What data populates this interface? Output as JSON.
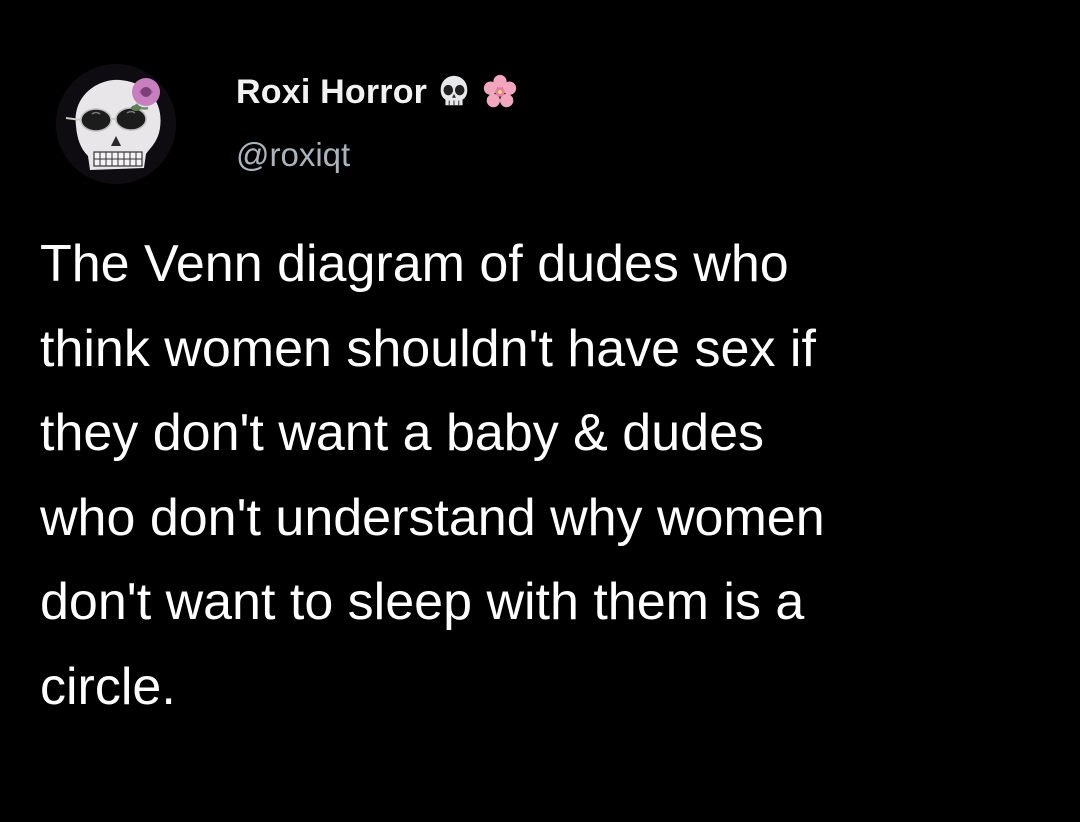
{
  "tweet": {
    "display_name": "Roxi Horror",
    "handle": "@roxiqt",
    "name_emojis": [
      "skull-emoji",
      "cherry-blossom-emoji"
    ],
    "avatar": "skull-with-sunglasses-and-rose-avatar",
    "body_lines": [
      "The Venn diagram of dudes who",
      "think women shouldn't have sex if",
      "they don't want a baby & dudes",
      "who don't understand why women",
      "don't want to sleep with them is a",
      "circle."
    ]
  },
  "colors": {
    "background": "#000000",
    "text": "#ffffff",
    "handle": "#aab4bd",
    "rose": "#c77fc0"
  }
}
